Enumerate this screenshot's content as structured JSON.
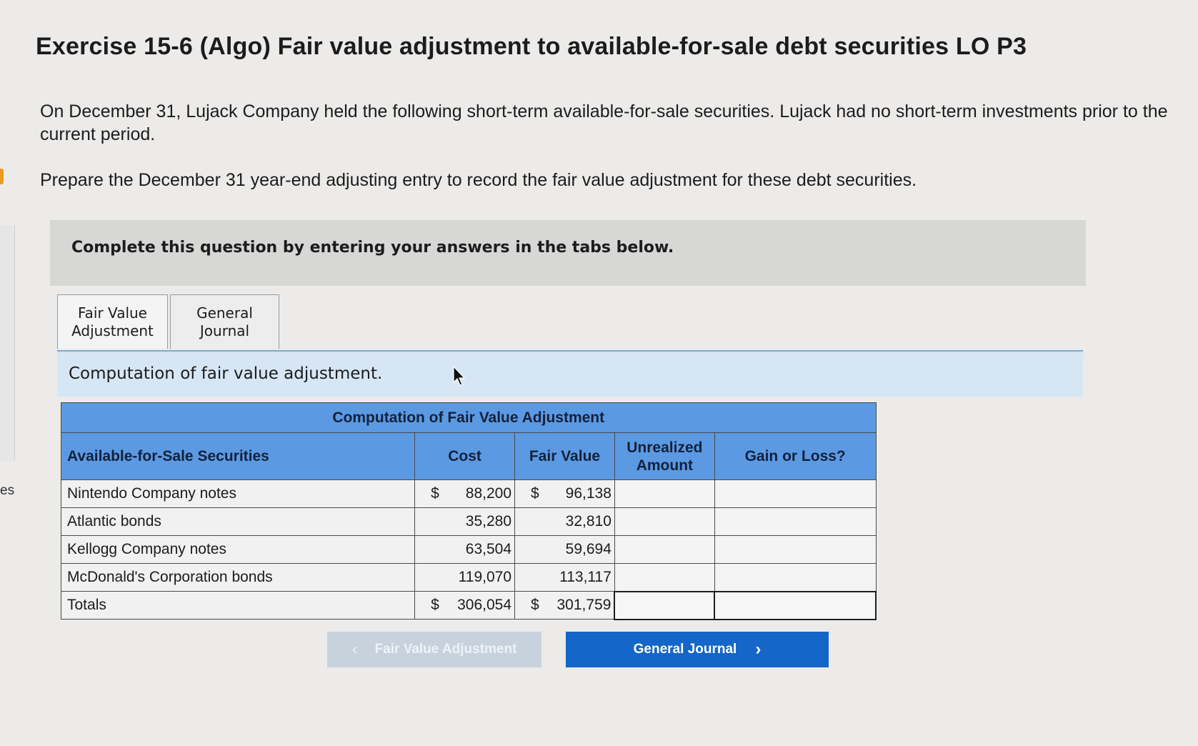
{
  "page": {
    "title": "Exercise 15-6 (Algo) Fair value adjustment to available-for-sale debt securities LO P3",
    "paragraph1": "On December 31, Lujack Company held the following short-term available-for-sale securities. Lujack had no short-term investments prior to the current period.",
    "paragraph2": "Prepare the December 31 year-end adjusting entry to record the fair value adjustment for these debt securities.",
    "edge_text": "es"
  },
  "instruction": "Complete this question by entering your answers in the tabs below.",
  "tabs": [
    {
      "label": "Fair Value Adjustment"
    },
    {
      "label": "General Journal"
    }
  ],
  "panel": {
    "caption": "Computation of fair value adjustment."
  },
  "table": {
    "caption": "Computation of Fair Value Adjustment",
    "columns": {
      "name": "Available-for-Sale Securities",
      "cost": "Cost",
      "fair_value": "Fair Value",
      "unrealized": "Unrealized Amount",
      "gain_loss": "Gain or Loss?"
    },
    "rows": [
      {
        "name": "Nintendo Company notes",
        "cost": "88,200",
        "fair_value": "96,138",
        "cost_dollar": "$",
        "fv_dollar": "$"
      },
      {
        "name": "Atlantic bonds",
        "cost": "35,280",
        "fair_value": "32,810"
      },
      {
        "name": "Kellogg Company notes",
        "cost": "63,504",
        "fair_value": "59,694"
      },
      {
        "name": "McDonald's Corporation bonds",
        "cost": "119,070",
        "fair_value": "113,117"
      }
    ],
    "totals": {
      "name": "Totals",
      "cost": "306,054",
      "fair_value": "301,759",
      "cost_dollar": "$",
      "fv_dollar": "$"
    }
  },
  "nav": {
    "prev_label": "Fair Value Adjustment",
    "next_label": "General Journal"
  },
  "colors": {
    "table_header": "#5b9ae3",
    "next_button": "#1466c8",
    "prev_button_disabled": "#c7d2dd",
    "panel_header": "#d6e6f4"
  },
  "icons": {
    "prev": "chevron-left-icon",
    "next": "chevron-right-icon",
    "cursor": "mouse-cursor-icon"
  }
}
